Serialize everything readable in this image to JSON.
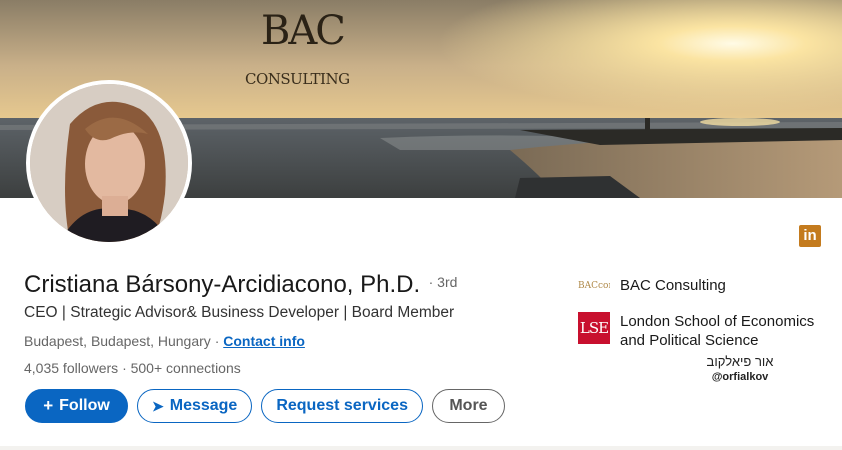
{
  "banner": {
    "logo_mark": "BAC",
    "logo_wordmark": "CONSULTING"
  },
  "profile": {
    "name": "Cristiana Bársony-Arcidiacono, Ph.D.",
    "degree": "· 3rd",
    "headline": "CEO | Strategic Advisor& Business Developer | Board Member",
    "location": "Budapest, Budapest, Hungary",
    "location_separator": "·",
    "contact_label": "Contact info",
    "followers": "4,035 followers",
    "connections": "· 500+ connections"
  },
  "actions": {
    "follow_glyph": "+",
    "follow_label": "Follow",
    "message_glyph": "➤",
    "message_label": "Message",
    "request_label": "Request services",
    "more_label": "More"
  },
  "sidebar": {
    "company_logo_text": "BACconsult",
    "company": "BAC Consulting",
    "school_logo_text": "LSE",
    "school": "London School of Economics and Political Science"
  },
  "watermark": {
    "line1": "אור פיאלקוב",
    "line2": "@orfialkov"
  },
  "linkedin_badge": "in",
  "colors": {
    "primary": "#0a66c2",
    "lse_red": "#c8102e",
    "linkedin_badge": "#c47b1e"
  },
  "icons": [
    "linkedin-icon",
    "plus-icon",
    "send-icon"
  ]
}
